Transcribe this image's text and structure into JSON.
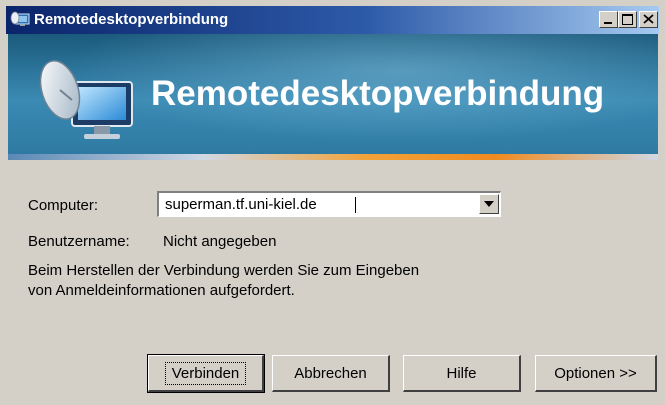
{
  "window": {
    "title": "Remotedesktopverbindung",
    "controls": {
      "minimize": "minimize",
      "maximize": "maximize",
      "close": "close"
    }
  },
  "banner": {
    "title": "Remotedesktopverbindung"
  },
  "form": {
    "computer_label": "Computer:",
    "computer_value": "superman.tf.uni-kiel.de",
    "username_label": "Benutzername:",
    "username_value": "Nicht angegeben",
    "info_line1": "Beim Herstellen der Verbindung werden Sie zum Eingeben",
    "info_line2": "von Anmeldeinformationen aufgefordert."
  },
  "buttons": {
    "connect": "Verbinden",
    "cancel": "Abbrechen",
    "help": "Hilfe",
    "options": "Optionen >>"
  },
  "colors": {
    "titlebar_start": "#0a246a",
    "banner": "#2e7aa3",
    "accent_stripe": "#f08a1e",
    "dialog_bg": "#d4d0c8"
  },
  "icons": {
    "app": "remote-desktop-icon",
    "banner": "remote-desktop-logo-icon",
    "dropdown": "chevron-down-icon"
  }
}
